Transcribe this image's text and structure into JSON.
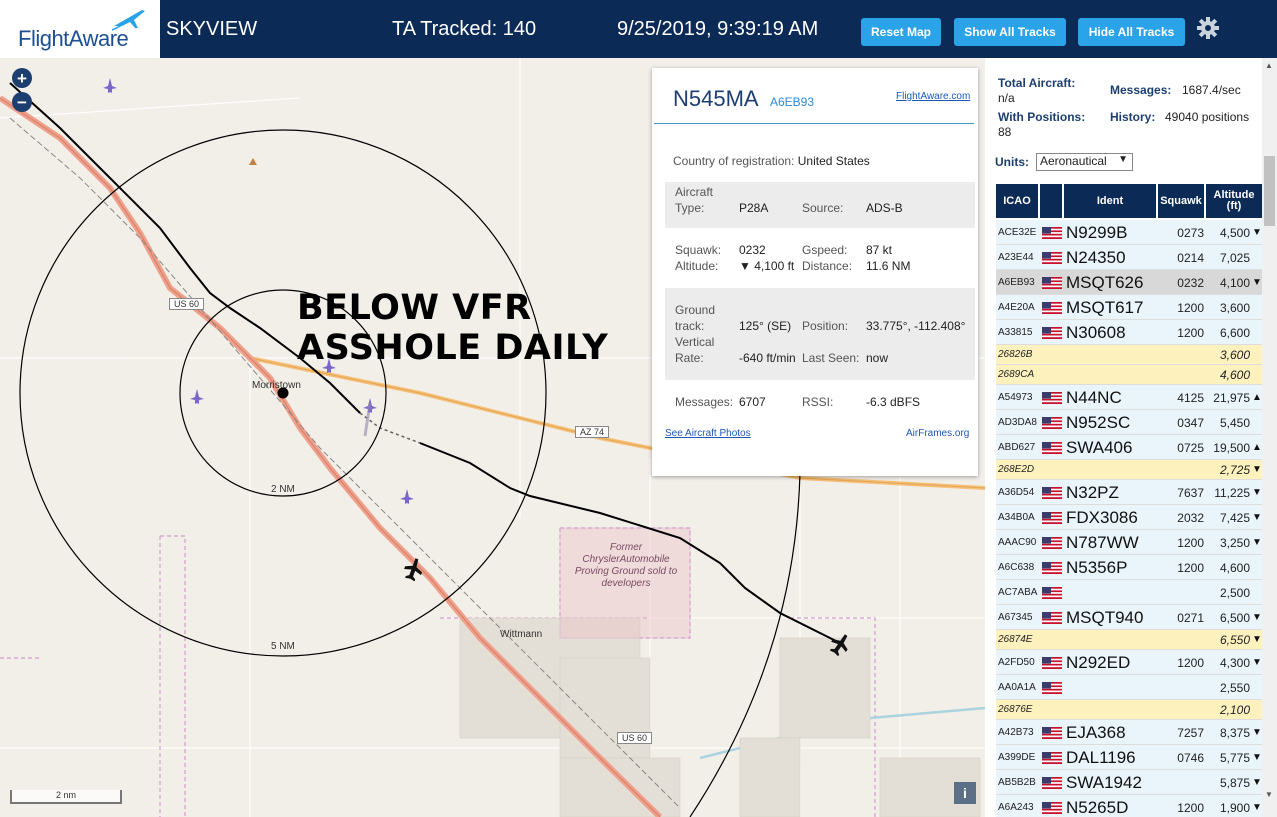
{
  "header": {
    "logo_text": "FlightAware",
    "title": "SKYVIEW",
    "tracked": "TA Tracked: 140",
    "datetime": "9/25/2019, 9:39:19 AM",
    "buttons": {
      "reset": "Reset Map",
      "show": "Show All Tracks",
      "hide": "Hide All Tracks"
    }
  },
  "map": {
    "overlay_line1": "BELOW VFR",
    "overlay_line2": "ASSHOLE DAILY",
    "town": "Morristown",
    "town2": "Wittmann",
    "ring_inner": "2 NM",
    "ring_outer": "5 NM",
    "shield_us60_a": "US 60",
    "shield_us60_b": "US 60",
    "shield_az74": "AZ 74",
    "former_text": "Former ChryslerAutomobile Proving Ground sold to developers",
    "scale": "2 nm",
    "info": "i",
    "zoom_in": "+",
    "zoom_out": "−"
  },
  "popup": {
    "ident": "N545MA",
    "icao": "A6EB93",
    "fa_link": "FlightAware.com",
    "country_label": "Country of registration:",
    "country": "United States",
    "aircraft_type_label1": "Aircraft",
    "aircraft_type_label2": "Type:",
    "aircraft_type": "P28A",
    "source_label": "Source:",
    "source": "ADS-B",
    "squawk_label": "Squawk:",
    "squawk": "0232",
    "gspeed_label": "Gspeed:",
    "gspeed": "87 kt",
    "altitude_label": "Altitude:",
    "altitude": "▼ 4,100 ft",
    "distance_label": "Distance:",
    "distance": "11.6 NM",
    "ground_label1": "Ground",
    "ground_label2": "track:",
    "ground_track": "125° (SE)",
    "position_label": "Position:",
    "position": "33.775°, -112.408°",
    "vrate_label1": "Vertical",
    "vrate_label2": "Rate:",
    "vrate": "-640 ft/min",
    "lastseen_label": "Last Seen:",
    "lastseen": "now",
    "messages_label": "Messages:",
    "messages": "6707",
    "rssi_label": "RSSI:",
    "rssi": "-6.3 dBFS",
    "photos_link": "See Aircraft Photos",
    "airframes_link": "AirFrames.org"
  },
  "side": {
    "total_label": "Total Aircraft:",
    "total": "n/a",
    "messages_label": "Messages:",
    "messages": "1687.4/sec",
    "withpos_label": "With Positions:",
    "withpos": "88",
    "history_label": "History:",
    "history": "49040 positions",
    "units_label": "Units:",
    "units": "Aeronautical",
    "columns": {
      "icao": "ICAO",
      "ident": "Ident",
      "squawk": "Squawk",
      "alt1": "Altitude",
      "alt2": "(ft)"
    },
    "rows": [
      {
        "icao": "ACE32E",
        "flag": true,
        "ident": "N9299B",
        "squawk": "0273",
        "alt": "4,500",
        "trend": "▼",
        "style": "normal"
      },
      {
        "icao": "A23E44",
        "flag": true,
        "ident": "N24350",
        "squawk": "0214",
        "alt": "7,025",
        "trend": "",
        "style": "normal"
      },
      {
        "icao": "A6EB93",
        "flag": true,
        "ident": "MSQT626",
        "squawk": "0232",
        "alt": "4,100",
        "trend": "▼",
        "style": "sel"
      },
      {
        "icao": "A4E20A",
        "flag": true,
        "ident": "MSQT617",
        "squawk": "1200",
        "alt": "3,600",
        "trend": "",
        "style": "normal"
      },
      {
        "icao": "A33815",
        "flag": true,
        "ident": "N30608",
        "squawk": "1200",
        "alt": "6,600",
        "trend": "",
        "style": "normal"
      },
      {
        "icao": "26826B",
        "flag": false,
        "ident": "",
        "squawk": "",
        "alt": "3,600",
        "trend": "",
        "style": "yellow"
      },
      {
        "icao": "2689CA",
        "flag": false,
        "ident": "",
        "squawk": "",
        "alt": "4,600",
        "trend": "",
        "style": "yellow"
      },
      {
        "icao": "A54973",
        "flag": true,
        "ident": "N44NC",
        "squawk": "4125",
        "alt": "21,975",
        "trend": "▲",
        "style": "normal"
      },
      {
        "icao": "AD3DA8",
        "flag": true,
        "ident": "N952SC",
        "squawk": "0347",
        "alt": "5,450",
        "trend": "",
        "style": "normal"
      },
      {
        "icao": "ABD627",
        "flag": true,
        "ident": "SWA406",
        "squawk": "0725",
        "alt": "19,500",
        "trend": "▲",
        "style": "normal"
      },
      {
        "icao": "268E2D",
        "flag": false,
        "ident": "",
        "squawk": "",
        "alt": "2,725",
        "trend": "▼",
        "style": "yellow"
      },
      {
        "icao": "A36D54",
        "flag": true,
        "ident": "N32PZ",
        "squawk": "7637",
        "alt": "11,225",
        "trend": "▼",
        "style": "normal"
      },
      {
        "icao": "A34B0A",
        "flag": true,
        "ident": "FDX3086",
        "squawk": "2032",
        "alt": "7,425",
        "trend": "▼",
        "style": "normal"
      },
      {
        "icao": "AAAC90",
        "flag": true,
        "ident": "N787WW",
        "squawk": "1200",
        "alt": "3,250",
        "trend": "▼",
        "style": "normal"
      },
      {
        "icao": "A6C638",
        "flag": true,
        "ident": "N5356P",
        "squawk": "1200",
        "alt": "4,600",
        "trend": "",
        "style": "normal"
      },
      {
        "icao": "AC7ABA",
        "flag": true,
        "ident": "",
        "squawk": "",
        "alt": "2,500",
        "trend": "",
        "style": "normal"
      },
      {
        "icao": "A67345",
        "flag": true,
        "ident": "MSQT940",
        "squawk": "0271",
        "alt": "6,500",
        "trend": "▼",
        "style": "normal"
      },
      {
        "icao": "26874E",
        "flag": false,
        "ident": "",
        "squawk": "",
        "alt": "6,550",
        "trend": "▼",
        "style": "yellow"
      },
      {
        "icao": "A2FD50",
        "flag": true,
        "ident": "N292ED",
        "squawk": "1200",
        "alt": "4,300",
        "trend": "▼",
        "style": "normal"
      },
      {
        "icao": "AA0A1A",
        "flag": true,
        "ident": "",
        "squawk": "",
        "alt": "2,550",
        "trend": "",
        "style": "normal"
      },
      {
        "icao": "26876E",
        "flag": false,
        "ident": "",
        "squawk": "",
        "alt": "2,100",
        "trend": "",
        "style": "yellow"
      },
      {
        "icao": "A42B73",
        "flag": true,
        "ident": "EJA368",
        "squawk": "7257",
        "alt": "8,375",
        "trend": "▼",
        "style": "normal"
      },
      {
        "icao": "A399DE",
        "flag": true,
        "ident": "DAL1196",
        "squawk": "0746",
        "alt": "5,775",
        "trend": "▼",
        "style": "normal"
      },
      {
        "icao": "AB5B2B",
        "flag": true,
        "ident": "SWA1942",
        "squawk": "",
        "alt": "5,875",
        "trend": "▼",
        "style": "normal"
      },
      {
        "icao": "A6A243",
        "flag": true,
        "ident": "N5265D",
        "squawk": "1200",
        "alt": "1,900",
        "trend": "▼",
        "style": "normal"
      }
    ]
  },
  "colors": {
    "header_bg": "#0b2a56",
    "button_bg": "#2aa3e8",
    "row_normal": "#e9f4fb",
    "row_selected": "#d8d8d8",
    "row_no_position": "#fdf2be",
    "highway": "#f0a08a",
    "track": "#000000"
  }
}
